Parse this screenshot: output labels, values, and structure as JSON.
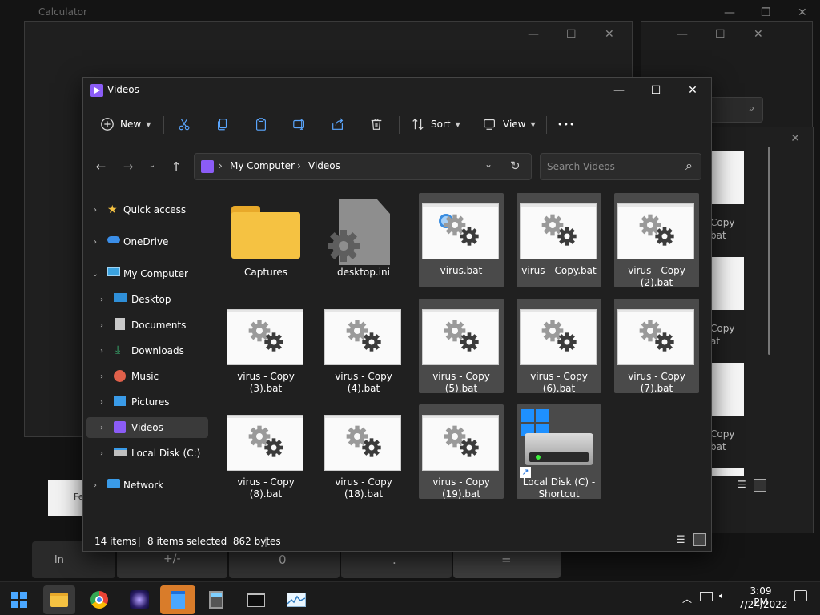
{
  "background_windows": {
    "calculator_title": "Calculator",
    "calculator_keys": [
      "ln",
      "+/-",
      "0",
      ".",
      "="
    ],
    "calc_partial_text": "Fe"
  },
  "right_window": {
    "items": [
      "Copy",
      "bat",
      "Copy",
      "at",
      "Copy",
      "bat",
      "Copy",
      "bat"
    ]
  },
  "window": {
    "title": "Videos",
    "controls": {
      "minimize": "—",
      "maximize": "☐",
      "close": "✕"
    }
  },
  "toolbar": {
    "new_label": "New",
    "sort_label": "Sort",
    "view_label": "View",
    "more_label": "•••"
  },
  "address": {
    "path": [
      "My Computer",
      "Videos"
    ],
    "separator": "›",
    "search_placeholder": "Search Videos"
  },
  "nav": {
    "quick_access": "Quick access",
    "onedrive": "OneDrive",
    "my_computer": "My Computer",
    "desktop": "Desktop",
    "documents": "Documents",
    "downloads": "Downloads",
    "music": "Music",
    "pictures": "Pictures",
    "videos": "Videos",
    "local_disk": "Local Disk (C:)",
    "network": "Network"
  },
  "files": [
    {
      "name": "Captures",
      "type": "folder",
      "selected": false
    },
    {
      "name": "desktop.ini",
      "type": "ini",
      "selected": false
    },
    {
      "name": "virus.bat",
      "type": "bat",
      "selected": true
    },
    {
      "name": "virus - Copy.bat",
      "type": "bat",
      "selected": true
    },
    {
      "name": "virus - Copy (2).bat",
      "type": "bat",
      "selected": true
    },
    {
      "name": "virus - Copy (3).bat",
      "type": "bat",
      "selected": false
    },
    {
      "name": "virus - Copy (4).bat",
      "type": "bat",
      "selected": false
    },
    {
      "name": "virus - Copy (5).bat",
      "type": "bat",
      "selected": true
    },
    {
      "name": "virus - Copy (6).bat",
      "type": "bat",
      "selected": true
    },
    {
      "name": "virus - Copy (7).bat",
      "type": "bat",
      "selected": true
    },
    {
      "name": "virus - Copy (8).bat",
      "type": "bat",
      "selected": false
    },
    {
      "name": "virus - Copy (18).bat",
      "type": "bat",
      "selected": false
    },
    {
      "name": "virus - Copy (19).bat",
      "type": "bat",
      "selected": true
    },
    {
      "name": "Local Disk (C) - Shortcut",
      "type": "shortcut",
      "selected": true
    }
  ],
  "status": {
    "item_count": "14 items",
    "selection": "8 items selected  862 bytes",
    "divider": "|"
  },
  "taskbar": {
    "time": "3:09 PM",
    "date": "7/24/2022",
    "apps": [
      "windows-start",
      "file-explorer",
      "chrome",
      "space-game",
      "notepad",
      "calculator",
      "terminal",
      "resource-monitor"
    ]
  },
  "colors": {
    "window_bg": "#202020",
    "selected_tile": "#4a4a4a",
    "accent": "#8b5cf6",
    "folder": "#f5c242"
  }
}
